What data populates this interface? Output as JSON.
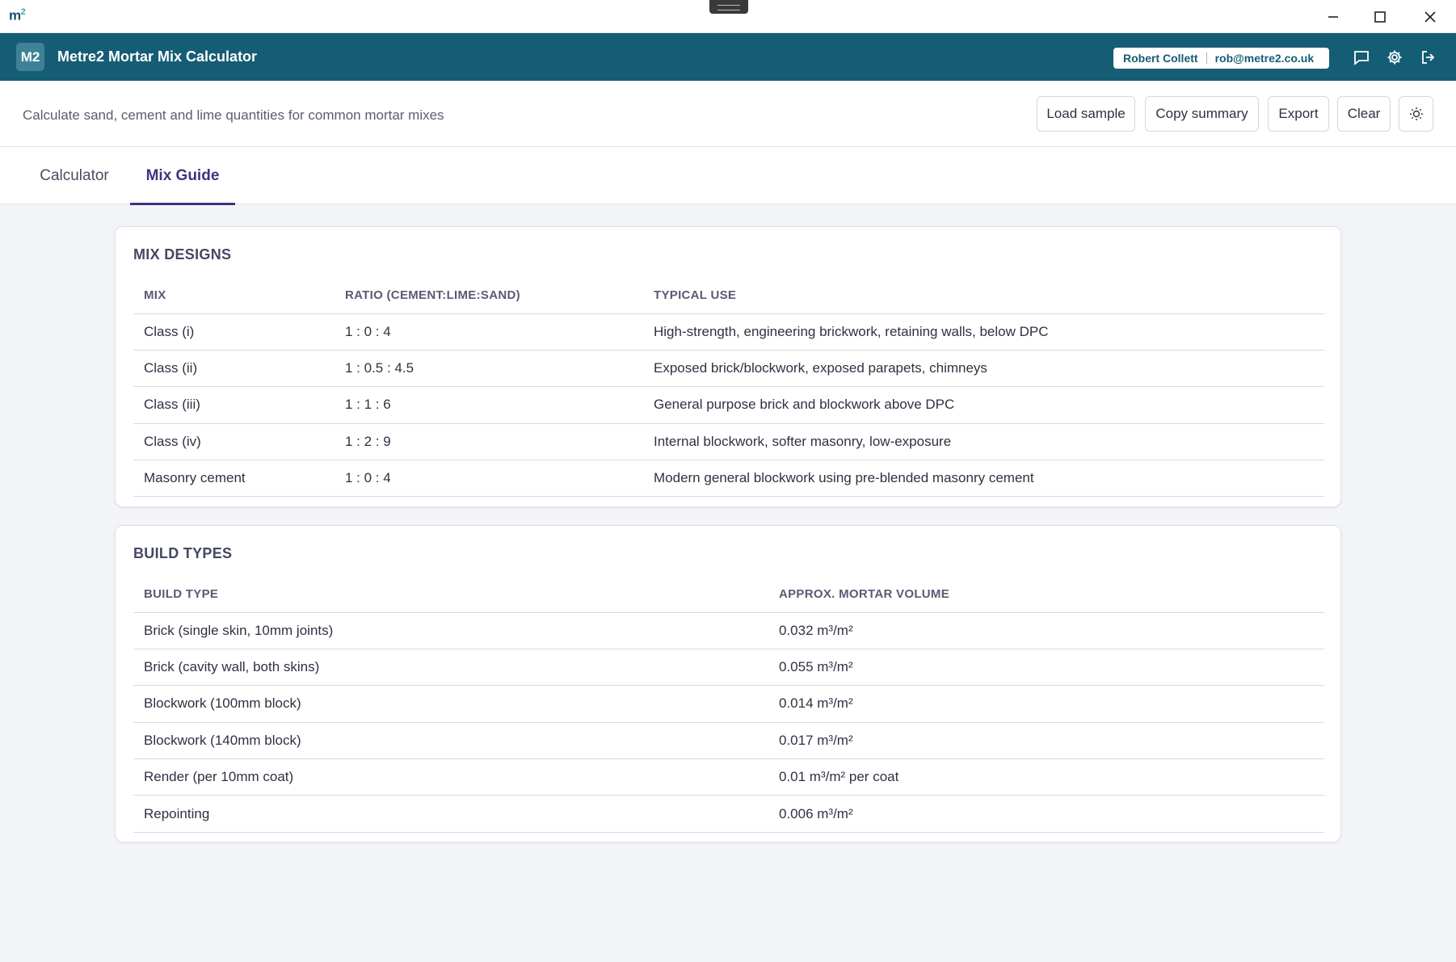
{
  "window": {
    "logo_text": "m",
    "logo_sup": "2",
    "minimize_icon": "minimize-icon",
    "maximize_icon": "maximize-icon",
    "close_icon": "close-icon"
  },
  "app": {
    "badge": "M2",
    "title": "Metre2 Mortar Mix Calculator",
    "user_name": "Robert Collett",
    "user_email": "rob@metre2.co.uk",
    "icons": [
      "chat-icon",
      "gear-icon",
      "logout-icon"
    ],
    "brand_color": "#155d74"
  },
  "toolbar": {
    "subtitle": "Calculate sand, cement and lime quantities for common mortar mixes",
    "load_sample": "Load sample",
    "copy_summary": "Copy summary",
    "export": "Export",
    "clear": "Clear",
    "theme_icon": "sun-icon"
  },
  "tabs": [
    {
      "label": "Calculator",
      "active": false
    },
    {
      "label": "Mix Guide",
      "active": true
    }
  ],
  "mix_designs": {
    "title": "MIX DESIGNS",
    "columns": [
      "MIX",
      "RATIO (CEMENT:LIME:SAND)",
      "TYPICAL USE"
    ],
    "rows": [
      [
        "Class (i)",
        "1 : 0 : 4",
        "High-strength, engineering brickwork, retaining walls, below DPC"
      ],
      [
        "Class (ii)",
        "1 : 0.5 : 4.5",
        "Exposed brick/blockwork, exposed parapets, chimneys"
      ],
      [
        "Class (iii)",
        "1 : 1 : 6",
        "General purpose brick and blockwork above DPC"
      ],
      [
        "Class (iv)",
        "1 : 2 : 9",
        "Internal blockwork, softer masonry, low-exposure"
      ],
      [
        "Masonry cement",
        "1 : 0 : 4",
        "Modern general blockwork using pre-blended masonry cement"
      ]
    ]
  },
  "build_types": {
    "title": "BUILD TYPES",
    "columns": [
      "BUILD TYPE",
      "APPROX. MORTAR VOLUME"
    ],
    "rows": [
      [
        "Brick (single skin, 10mm joints)",
        "0.032 m³/m²"
      ],
      [
        "Brick (cavity wall, both skins)",
        "0.055 m³/m²"
      ],
      [
        "Blockwork (100mm block)",
        "0.014 m³/m²"
      ],
      [
        "Blockwork (140mm block)",
        "0.017 m³/m²"
      ],
      [
        "Render (per 10mm coat)",
        "0.01 m³/m² per coat"
      ],
      [
        "Repointing",
        "0.006 m³/m²"
      ]
    ]
  }
}
